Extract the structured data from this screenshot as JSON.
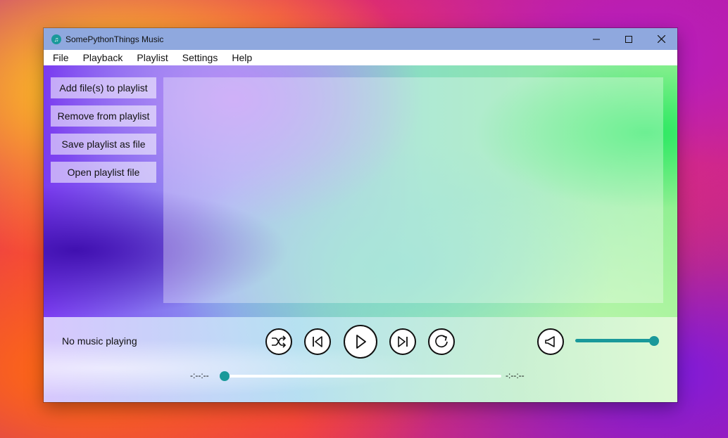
{
  "window": {
    "title": "SomePythonThings Music",
    "minimize_icon": "—",
    "maximize_icon": "☐",
    "close_icon": "✕"
  },
  "menu": [
    "File",
    "Playback",
    "Playlist",
    "Settings",
    "Help"
  ],
  "sidebar": {
    "buttons": [
      "Add file(s) to  playlist",
      "Remove from playlist",
      "Save playlist as file",
      "Open playlist file"
    ]
  },
  "player": {
    "status": "No music playing",
    "time_elapsed": "-:--:--",
    "time_total": "-:--:--",
    "progress": 0,
    "volume": 1.0,
    "accent_color": "#19999a",
    "controls": [
      "shuffle-icon",
      "previous-icon",
      "play-icon",
      "next-icon",
      "repeat-icon",
      "volume-icon"
    ]
  }
}
